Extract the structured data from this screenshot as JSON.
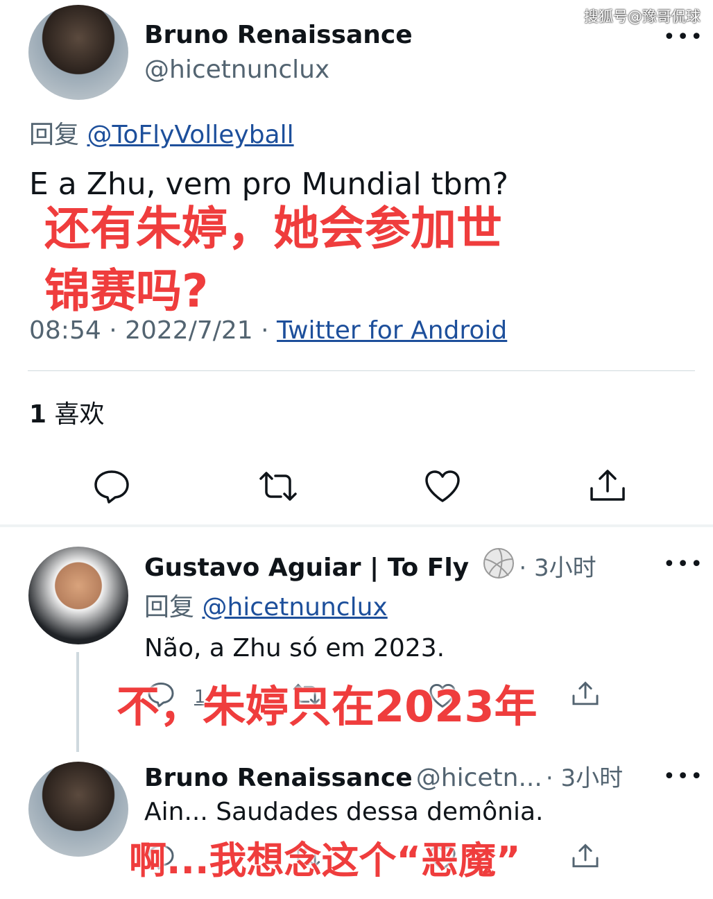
{
  "watermark": "搜狐号@豫哥侃球",
  "main_tweet": {
    "author_name": "Bruno Renaissance",
    "author_handle": "@hicetnunclux",
    "reply_prefix": "回复",
    "reply_to": "@ToFlyVolleyball",
    "text": "E a Zhu, vem pro Mundial tbm?",
    "overlay_line1": "还有朱婷，她会参加世",
    "overlay_line2": "锦赛吗?",
    "time": "08:54",
    "date": "2022/7/21",
    "source": "Twitter for Android",
    "likes_count": "1",
    "likes_label": "喜欢",
    "more": "•••"
  },
  "reply1": {
    "author_name": "Gustavo Aguiar | To Fly",
    "badge_icon": "volleyball-icon",
    "time": "3小时",
    "reply_prefix": "回复",
    "reply_to": "@hicetnunclux",
    "text": "Não, a Zhu só em 2023.",
    "overlay": "不，朱婷只在2023年",
    "reply_count": "1",
    "more": "•••"
  },
  "reply2": {
    "author_name": "Bruno Renaissance",
    "author_handle": "@hicetn...",
    "time": "3小时",
    "text": "Ain... Saudades dessa demônia.",
    "overlay": "啊...我想念这个“恶魔”",
    "more": "•••"
  },
  "colors": {
    "link": "#1d4f9b",
    "overlay": "#ef3d3d",
    "muted": "#536471"
  }
}
